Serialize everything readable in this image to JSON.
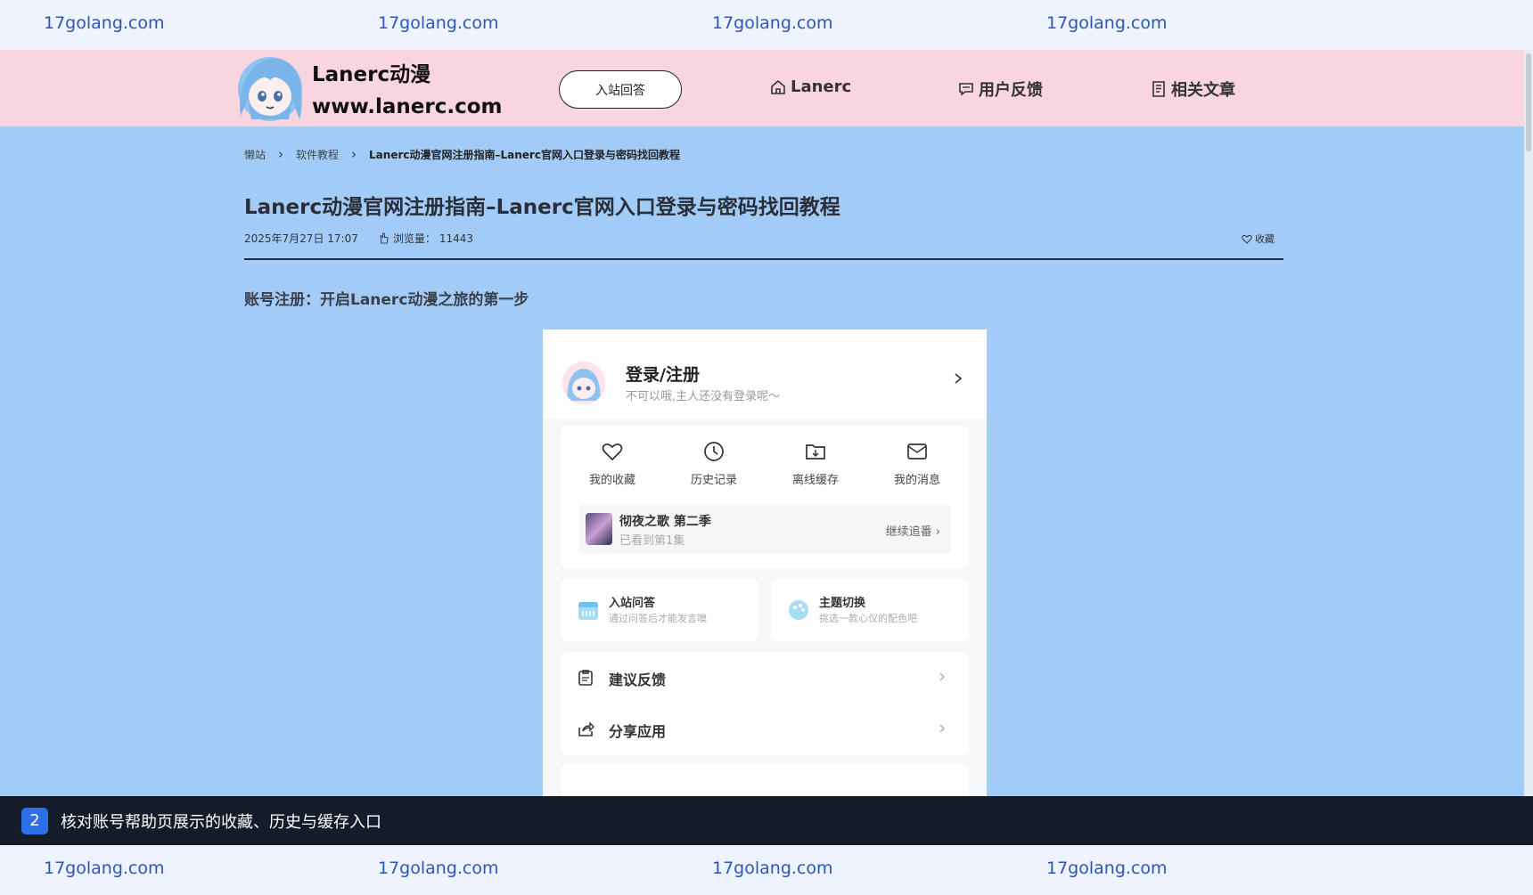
{
  "watermarks": {
    "top": [
      "17golang.com",
      "17golang.com",
      "17golang.com",
      "17golang.com"
    ],
    "bottom": [
      "17golang.com",
      "17golang.com",
      "17golang.com",
      "17golang.com"
    ]
  },
  "header": {
    "logo_line1": "Lanerc动漫",
    "logo_line2": "www.lanerc.com",
    "qa_button": "入站回答",
    "nav": [
      "Lanerc",
      "用户反馈",
      "相关文章"
    ]
  },
  "breadcrumb": {
    "home": "懒站",
    "category": "软件教程",
    "current": "Lanerc动漫官网注册指南–Lanerc官网入口登录与密码找回教程"
  },
  "article": {
    "title": "Lanerc动漫官网注册指南–Lanerc官网入口登录与密码找回教程",
    "date": "2025年7月27日 17:07",
    "views_label": "浏览量：",
    "views": "11443",
    "favorite": "收藏",
    "section_heading": "账号注册：开启Lanerc动漫之旅的第一步"
  },
  "phone": {
    "login_title": "登录/注册",
    "login_sub": "不可以哦,主人还没有登录呢～",
    "quick": [
      "我的收藏",
      "历史记录",
      "离线缓存",
      "我的消息"
    ],
    "continue": {
      "title": "彻夜之歌 第二季",
      "sub": "已看到第1集",
      "button": "继续追番"
    },
    "mini": [
      {
        "title": "入站问答",
        "sub": "通过问答后才能发言噢"
      },
      {
        "title": "主题切换",
        "sub": "挑选一款心仪的配色吧"
      }
    ],
    "list": [
      "建议反馈",
      "分享应用"
    ]
  },
  "caption": {
    "step": "2",
    "text": "核对账号帮助页展示的收藏、历史与缓存入口"
  },
  "colors": {
    "header_bg": "#f8d5df",
    "page_bg": "#a3cbf8",
    "caption_bg": "#141b2a",
    "step_badge": "#2c6fe8"
  }
}
